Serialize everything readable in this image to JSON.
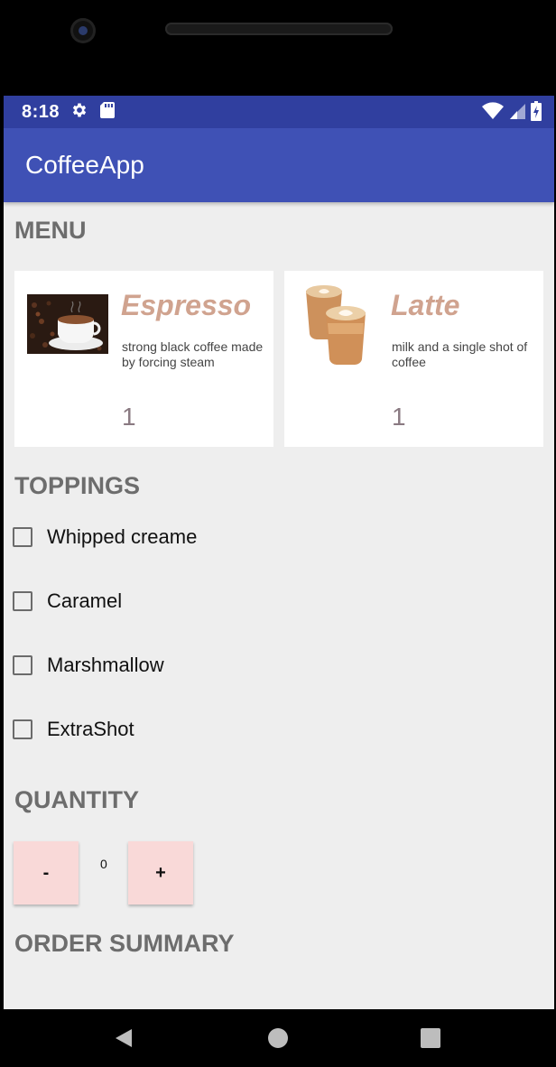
{
  "status_bar": {
    "time": "8:18"
  },
  "app_bar": {
    "title": "CoffeeApp"
  },
  "sections": {
    "menu": "MENU",
    "toppings": "TOPPINGS",
    "quantity": "QUANTITY",
    "summary": "ORDER SUMMARY"
  },
  "menu_items": [
    {
      "name": "Espresso",
      "description": "strong black coffee made by forcing steam",
      "count": "1"
    },
    {
      "name": "Latte",
      "description": "milk and a single shot of coffee",
      "count": "1"
    }
  ],
  "toppings": [
    {
      "label": "Whipped creame",
      "checked": false
    },
    {
      "label": "Caramel",
      "checked": false
    },
    {
      "label": "Marshmallow",
      "checked": false
    },
    {
      "label": "ExtraShot",
      "checked": false
    }
  ],
  "quantity": {
    "minus_label": "-",
    "plus_label": "+",
    "value": "0"
  },
  "colors": {
    "status_bar": "#303f9f",
    "app_bar": "#3f51b5",
    "background": "#eeeeee",
    "item_name": "#d0a38f",
    "button": "#f9d9d8"
  },
  "icons": {
    "status": [
      "gear-icon",
      "sd-card-icon"
    ],
    "status_right": [
      "wifi-icon",
      "signal-icon",
      "battery-icon"
    ],
    "nav": [
      "back-icon",
      "home-icon",
      "recents-icon"
    ]
  }
}
